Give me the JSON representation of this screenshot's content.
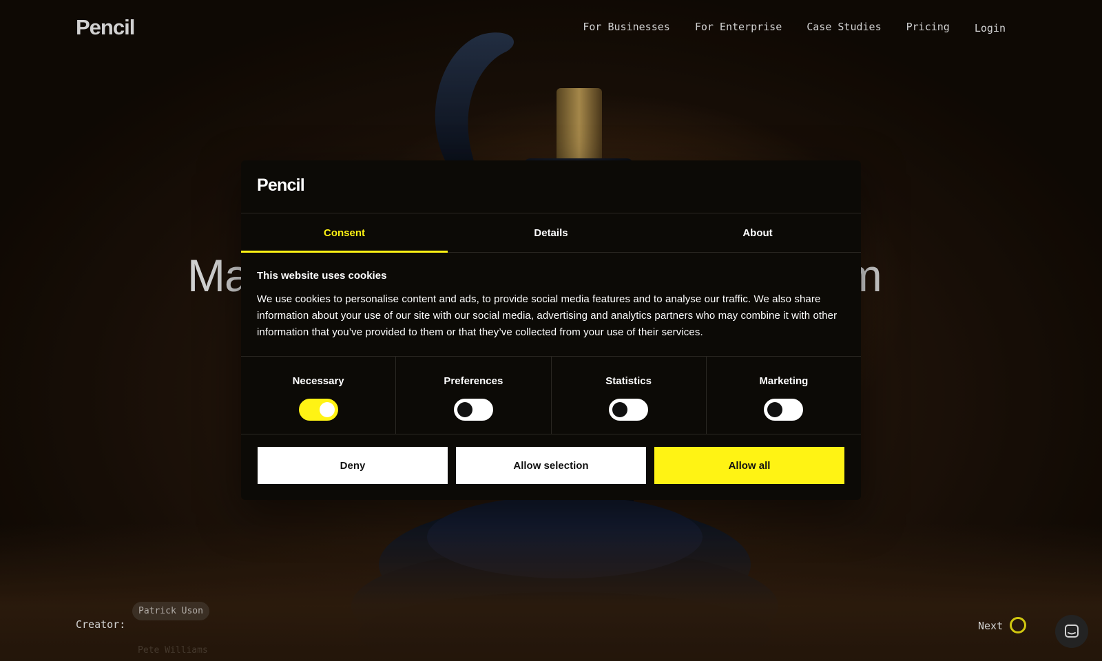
{
  "brand": {
    "logo_text": "Pencil",
    "accent_color": "#fff314"
  },
  "nav": {
    "items": [
      "For Businesses",
      "For Enterprise",
      "Case Studies",
      "Pricing"
    ],
    "login": "Login"
  },
  "hero": {
    "title_left": "Ma",
    "title_right": "em"
  },
  "footer": {
    "creator_label": "Creator:",
    "creator_name": "Patrick Uson",
    "creator_next_name": "Pete Williams",
    "next_label": "Next",
    "chat_icon": "chat-icon"
  },
  "cookie_modal": {
    "logo_text": "Pencil",
    "tabs": [
      {
        "label": "Consent",
        "active": true
      },
      {
        "label": "Details",
        "active": false
      },
      {
        "label": "About",
        "active": false
      }
    ],
    "heading": "This website uses cookies",
    "body": "We use cookies to personalise content and ads, to provide social media features and to analyse our traffic. We also share information about your use of our site with our social media, advertising and analytics partners who may combine it with other information that you’ve provided to them or that they’ve collected from your use of their services.",
    "categories": [
      {
        "label": "Necessary",
        "enabled": true
      },
      {
        "label": "Preferences",
        "enabled": false
      },
      {
        "label": "Statistics",
        "enabled": false
      },
      {
        "label": "Marketing",
        "enabled": false
      }
    ],
    "buttons": {
      "deny": "Deny",
      "allow_selection": "Allow selection",
      "allow_all": "Allow all"
    }
  }
}
